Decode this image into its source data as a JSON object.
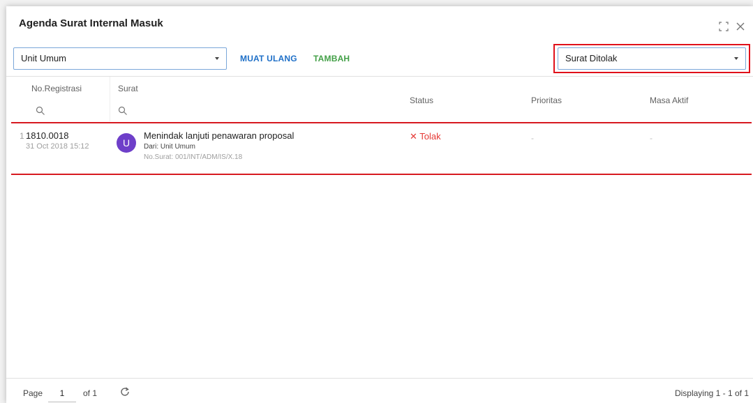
{
  "window": {
    "title": "Agenda Surat Internal Masuk"
  },
  "toolbar": {
    "unit_select": "Unit Umum",
    "reload_label": "MUAT ULANG",
    "add_label": "TAMBAH",
    "filter_select": "Surat Ditolak"
  },
  "columns": {
    "registration": "No.Registrasi",
    "letter": "Surat",
    "status": "Status",
    "priority": "Prioritas",
    "active_period": "Masa Aktif"
  },
  "rows": [
    {
      "number": "1",
      "registration_no": "1810.0018",
      "date": "31 Oct 2018 15:12",
      "avatar_letter": "U",
      "subject": "Menindak lanjuti penawaran proposal",
      "sender": "Dari: Unit Umum",
      "letter_no": "No.Surat: 001/INT/ADM/IS/X.18",
      "status": "✕ Tolak",
      "priority": "-",
      "active_period": "-"
    }
  ],
  "footer": {
    "page_label": "Page",
    "page_value": "1",
    "of_label": "of 1",
    "displaying": "Displaying 1 - 1 of 1"
  },
  "colors": {
    "reload": "#1e6fc7",
    "add": "#43a047",
    "status_rejected": "#e53935",
    "highlight": "#e0101a",
    "avatar": "#6e3fc9"
  },
  "icons": {
    "maximize": "maximize-icon",
    "close": "close-icon",
    "search": "search-icon",
    "refresh": "refresh-icon"
  }
}
